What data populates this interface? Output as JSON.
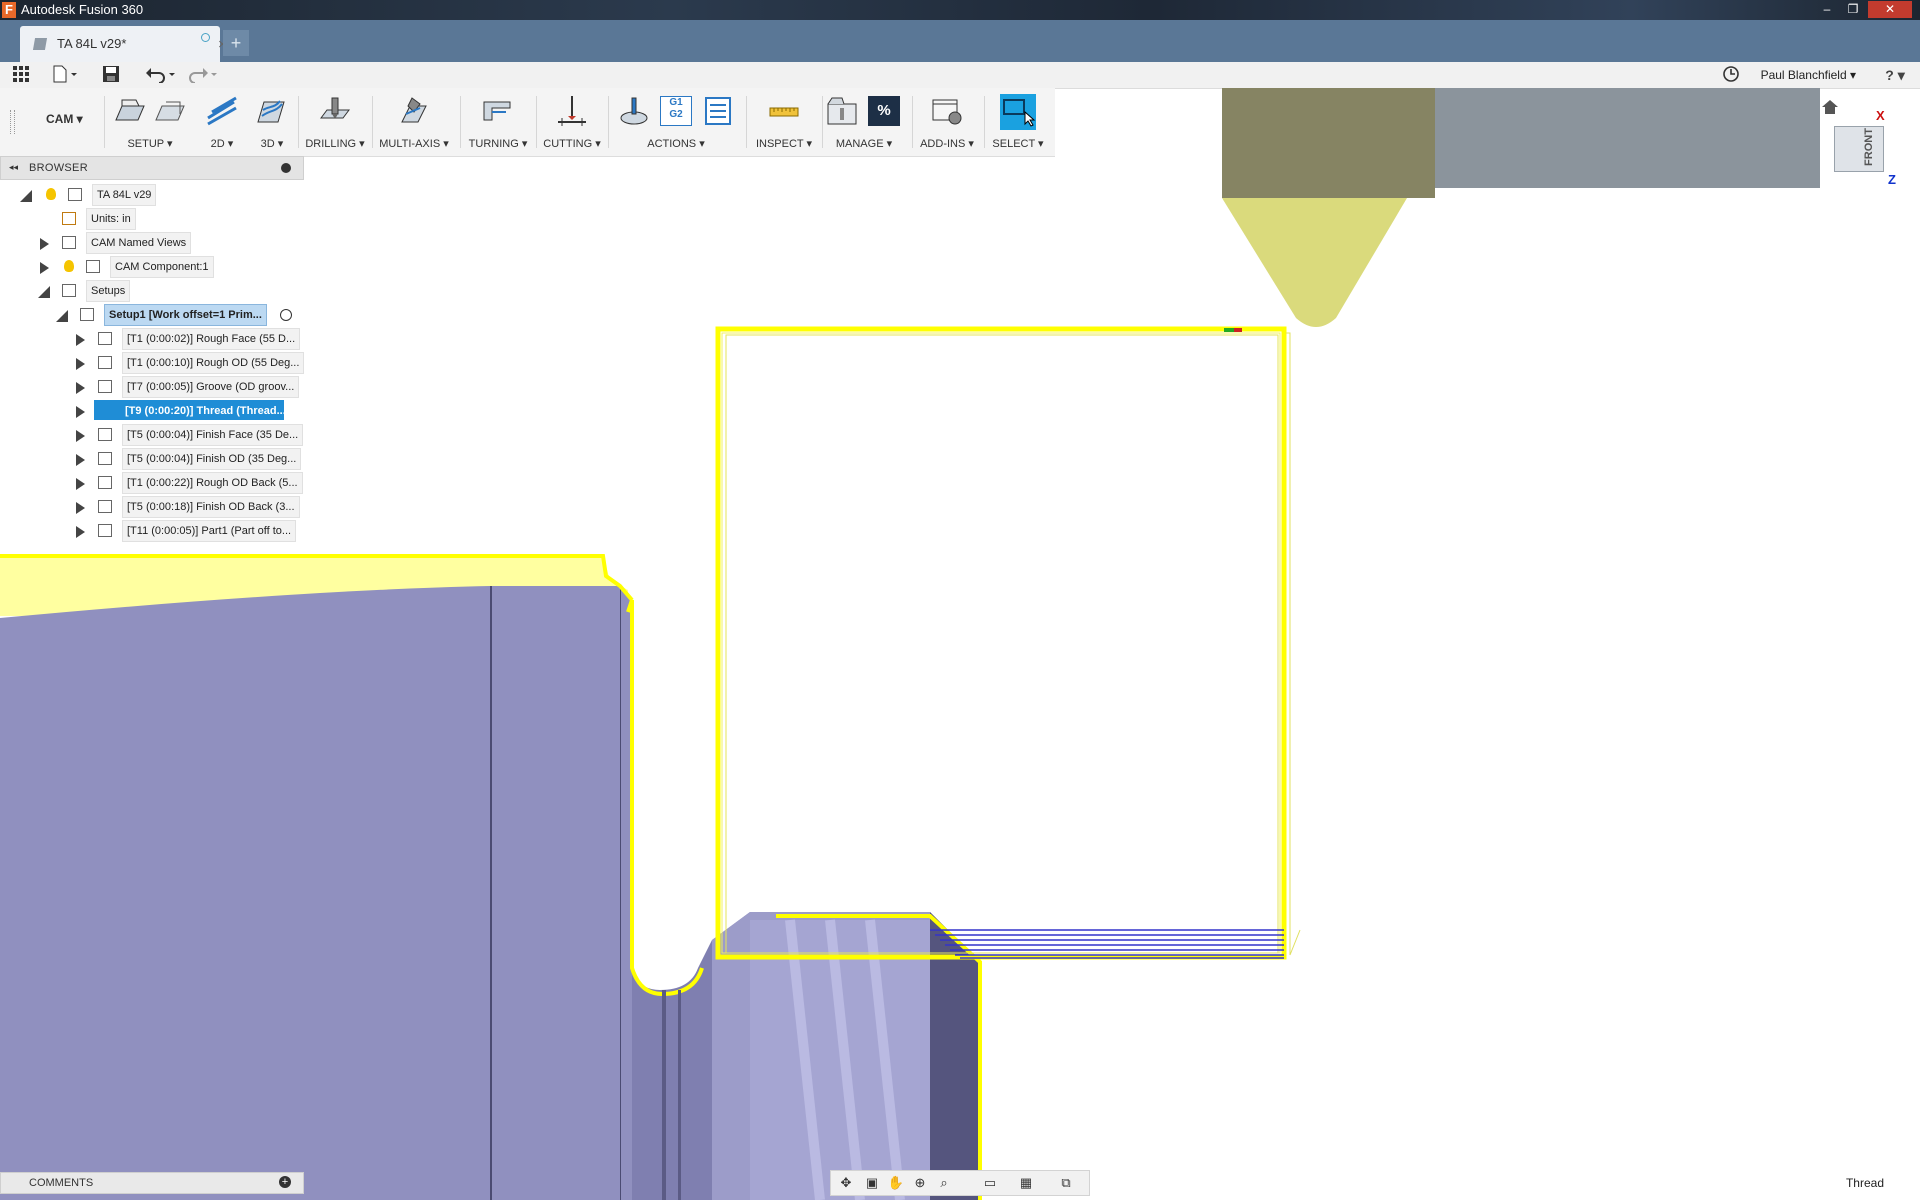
{
  "window": {
    "title": "Autodesk Fusion 360",
    "app_logo_letter": "F",
    "minimize_glyph": "–",
    "restore_glyph": "❐",
    "close_glyph": "✕"
  },
  "tabs": {
    "document_tab": "TA 84L v29*",
    "close_glyph": "×",
    "new_tab_glyph": "+"
  },
  "quick_access": {
    "apps_icon": "grid-icon",
    "file_icon": "file-icon",
    "save_icon": "save-icon",
    "undo_icon": "undo-icon",
    "redo_icon": "redo-icon",
    "clock_icon": "clock-icon",
    "user_name": "Paul Blanchfield ▾",
    "help_label": "? ▾"
  },
  "toolbar": {
    "workspace": "CAM ▾",
    "groups": [
      {
        "label": "SETUP ▾"
      },
      {
        "label": "2D ▾"
      },
      {
        "label": "3D ▾"
      },
      {
        "label": "DRILLING ▾"
      },
      {
        "label": "MULTI-AXIS ▾"
      },
      {
        "label": "TURNING ▾"
      },
      {
        "label": "CUTTING ▾"
      },
      {
        "label": "ACTIONS ▾"
      },
      {
        "label": "INSPECT ▾"
      },
      {
        "label": "MANAGE ▾"
      },
      {
        "label": "ADD-INS ▾"
      },
      {
        "label": "SELECT ▾"
      }
    ],
    "actions_g1g2": "G1",
    "actions_g1g2_b": "G2",
    "manage_percent": "%"
  },
  "browser": {
    "title": "BROWSER",
    "collapse_glyph": "◂◂",
    "root": "TA 84L v29",
    "units": "Units: in",
    "named_views": "CAM Named Views",
    "component": "CAM Component:1",
    "setups": "Setups",
    "setup1": "Setup1 [Work offset=1 Prim...",
    "operations": [
      "[T1 (0:00:02)] Rough Face (55 D...",
      "[T1 (0:00:10)] Rough OD (55 Deg...",
      "[T7 (0:00:05)] Groove (OD groov...",
      "[T9 (0:00:20)] Thread (Thread...",
      "[T5 (0:00:04)] Finish Face (35 De...",
      "[T5 (0:00:04)] Finish OD (35 Deg...",
      "[T1 (0:00:22)] Rough OD Back (5...",
      "[T5 (0:00:18)] Finish OD Back (3...",
      "[T11 (0:00:05)] Part1 (Part off to..."
    ],
    "selected_index": 3
  },
  "comments": {
    "title": "COMMENTS",
    "add_glyph": "+"
  },
  "viewcube": {
    "face": "FRONT",
    "axis_x": "X",
    "axis_z": "Z",
    "home_icon": "home-icon"
  },
  "status": {
    "right_text": "Thread"
  },
  "colors": {
    "part_fill": "#8f8fbd",
    "stock_fill": "#ffff99",
    "toolpath_yellow": "#ffff00",
    "toolpath_blue": "#3333cc",
    "tool_holder": "#8a8a6a",
    "insert": "#dada7c",
    "selection_blue": "#1f8dd6"
  }
}
